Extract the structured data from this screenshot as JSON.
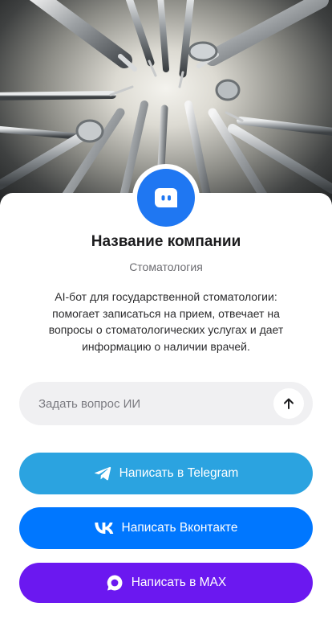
{
  "company": {
    "name": "Название компании",
    "category": "Стоматология",
    "description": "AI-бот для государственной стоматологии: помогает записаться на прием, отвечает на вопросы о стоматологических услугах и дает информацию о наличии врачей."
  },
  "ask": {
    "placeholder": "Задать вопрос ИИ"
  },
  "buttons": {
    "telegram": "Написать в Telegram",
    "vk": "Написать Вконтакте",
    "max": "Написать в MAX"
  },
  "colors": {
    "avatar": "#1f77f2",
    "telegram": "#2ba3e0",
    "vk": "#0077ff",
    "max": "#6b18f0",
    "ask_bg": "#f0f0f2"
  },
  "icons": {
    "avatar": "bot-chat-icon",
    "send": "arrow-up-icon",
    "telegram": "telegram-icon",
    "vk": "vk-icon",
    "max": "max-icon",
    "hero": "dental-instruments-photo"
  }
}
